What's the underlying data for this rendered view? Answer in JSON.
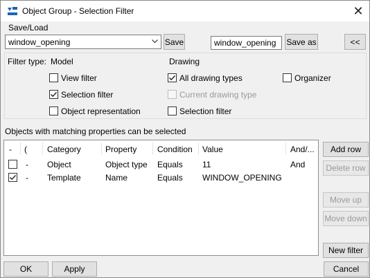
{
  "window": {
    "title": "Object Group - Selection Filter",
    "close_symbol": "✕"
  },
  "save_load": {
    "group_label": "Save/Load",
    "selected_filter": "window_opening",
    "save_label": "Save",
    "save_as_name": "window_opening",
    "save_as_label": "Save as",
    "collapse_label": "<<"
  },
  "filter_type": {
    "label": "Filter type:",
    "model_header": "Model",
    "drawing_header": "Drawing",
    "model_options": [
      {
        "label": "View filter",
        "checked": false
      },
      {
        "label": "Selection filter",
        "checked": true
      },
      {
        "label": "Object representation",
        "checked": false
      }
    ],
    "drawing_options": [
      {
        "label": "All drawing types",
        "checked": true,
        "enabled": true
      },
      {
        "label": "Current drawing type",
        "checked": false,
        "enabled": false
      },
      {
        "label": "Selection filter",
        "checked": false,
        "enabled": true
      }
    ],
    "organizer": {
      "label": "Organizer",
      "checked": false
    }
  },
  "rules": {
    "caption": "Objects with matching properties can be selected",
    "columns": [
      "-",
      "(",
      "Category",
      "Property",
      "Condition",
      "Value",
      "And/..."
    ],
    "rows": [
      {
        "checked": false,
        "paren": "-",
        "category": "Object",
        "property": "Object type",
        "condition": "Equals",
        "value": "11",
        "andor": "And"
      },
      {
        "checked": true,
        "paren": "-",
        "category": "Template",
        "property": "Name",
        "condition": "Equals",
        "value": "WINDOW_OPENING",
        "andor": ""
      }
    ]
  },
  "side_buttons": {
    "add_row": "Add row",
    "delete_row": "Delete row",
    "move_up": "Move up",
    "move_down": "Move down",
    "new_filter": "New filter"
  },
  "footer": {
    "ok": "OK",
    "apply": "Apply",
    "cancel": "Cancel"
  },
  "colors": {
    "accent": "#0078d7",
    "disabled_text": "#9a9a9a"
  }
}
